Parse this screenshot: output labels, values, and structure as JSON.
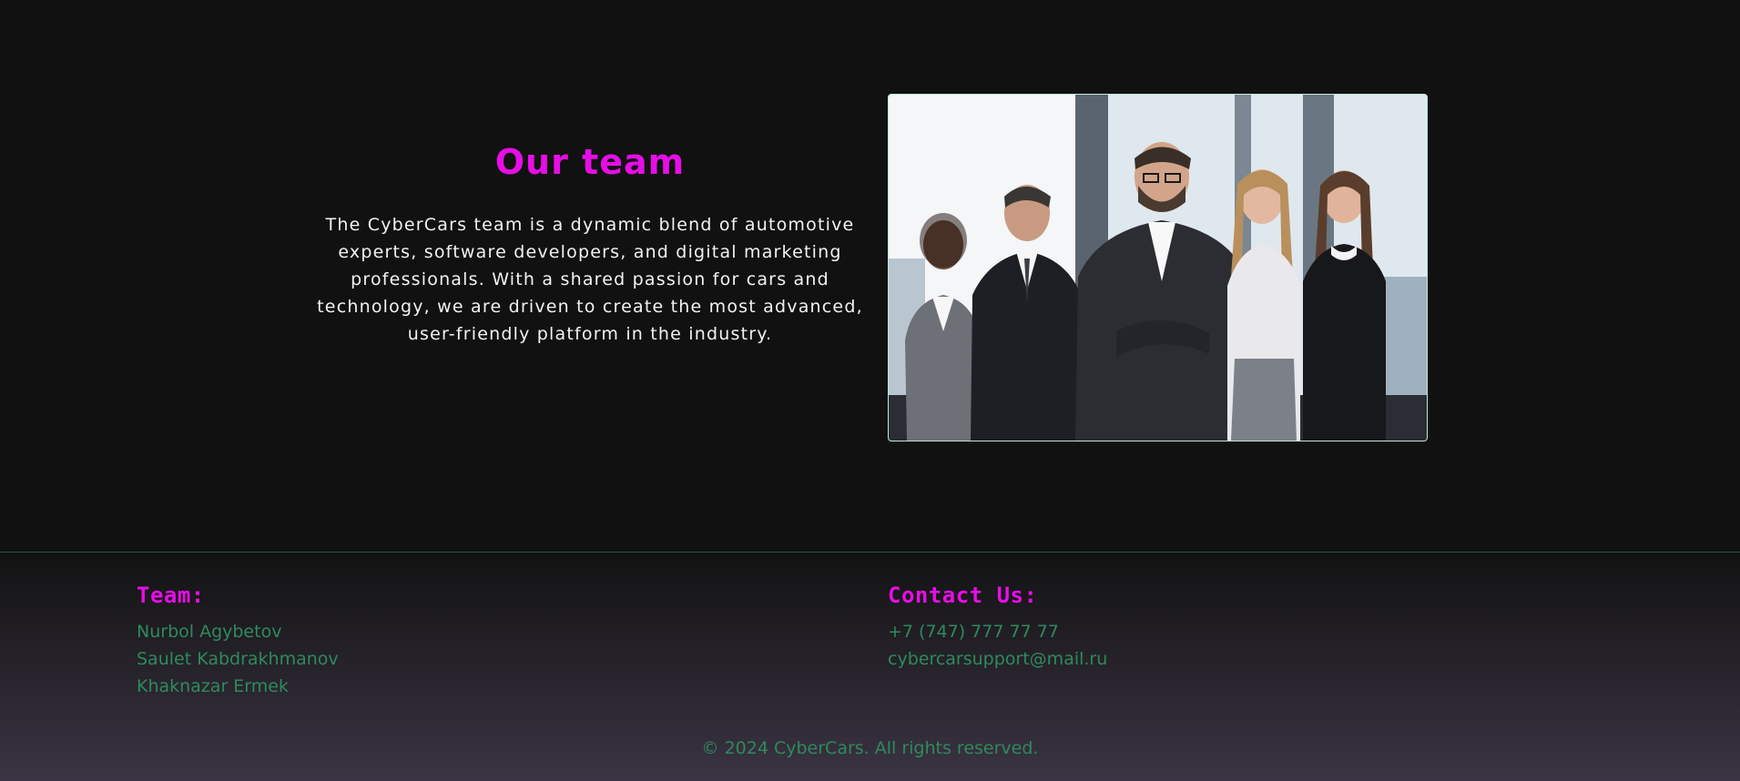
{
  "team_section": {
    "heading": "Our team",
    "description": "The CyberCars team is a dynamic blend of automotive experts, software developers, and digital marketing professionals. With a shared passion for cars and technology, we are driven to create the most advanced, user-friendly platform in the industry."
  },
  "footer": {
    "team": {
      "heading": "Team:",
      "members": [
        "Nurbol Agybetov",
        "Saulet Kabdrakhmanov",
        "Khaknazar Ermek"
      ]
    },
    "contact": {
      "heading": "Contact Us:",
      "phone": "+7 (747) 777 77 77",
      "email": "cybercarsupport@mail.ru"
    },
    "copyright": "© 2024 CyberCars. All rights reserved."
  },
  "colors": {
    "accent": "#e60ee6",
    "link_green": "#2f8a5c",
    "background": "#111111"
  }
}
